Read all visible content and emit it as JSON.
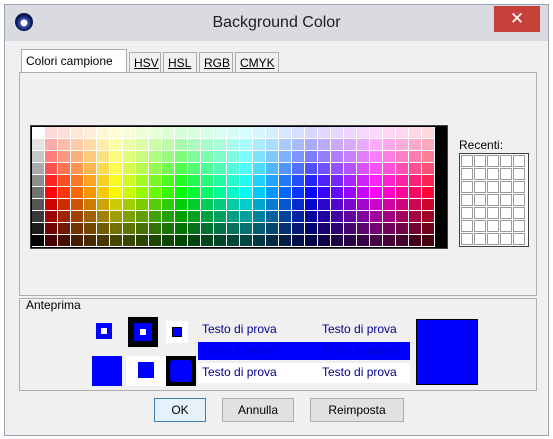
{
  "window": {
    "title": "Background Color",
    "close_label": "✕"
  },
  "tabs": [
    {
      "label": "Colori campione",
      "active": true
    },
    {
      "label": "HSV"
    },
    {
      "label": "HSL"
    },
    {
      "label": "RGB"
    },
    {
      "label": "CMYK"
    }
  ],
  "swatches": {
    "recent_label": "Recenti:"
  },
  "preview": {
    "label": "Anteprima",
    "sample_text": "Testo di prova",
    "selected_color": "#0000ff"
  },
  "buttons": {
    "ok": "OK",
    "cancel": "Annulla",
    "reset": "Reimposta"
  }
}
